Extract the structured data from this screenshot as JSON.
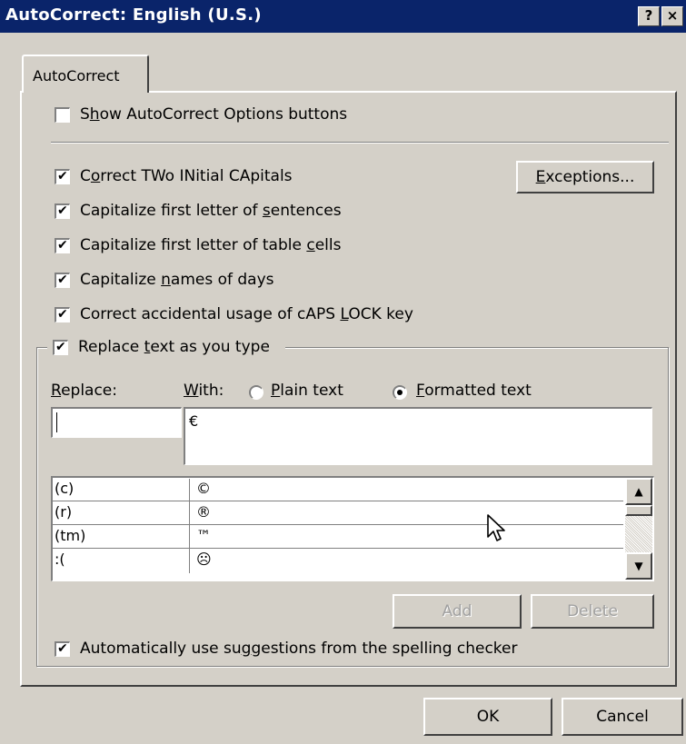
{
  "window": {
    "title": "AutoCorrect: English (U.S.)",
    "help_label": "?",
    "close_label": "×"
  },
  "tabs": [
    {
      "label": "AutoCorrect",
      "active": true
    }
  ],
  "options": {
    "show_buttons": {
      "label_pre": "S",
      "label_key": "h",
      "label_post": "ow AutoCorrect Options buttons",
      "checked": false
    },
    "correct_two_initial": {
      "label_pre": "C",
      "label_key": "o",
      "label_post": "rrect TWo INitial CApitals",
      "checked": true
    },
    "capitalize_sentences": {
      "label_pre": "Capitalize first letter of ",
      "label_key": "s",
      "label_post": "entences",
      "checked": true
    },
    "capitalize_table_cells": {
      "label_pre": "Capitalize first letter of table ",
      "label_key": "c",
      "label_post": "ells",
      "checked": true
    },
    "capitalize_days": {
      "label_pre": "Capitalize ",
      "label_key": "n",
      "label_post": "ames of days",
      "checked": true
    },
    "caps_lock": {
      "label_pre": "Correct accidental usage of cAPS ",
      "label_key": "L",
      "label_post": "OCK key",
      "checked": true
    },
    "replace_as_type": {
      "label_pre": "Replace ",
      "label_key": "t",
      "label_post": "ext as you type",
      "checked": true
    },
    "auto_suggestions": {
      "label_pre": "Automatically use su",
      "label_key": "g",
      "label_post": "gestions from the spelling checker",
      "checked": true
    }
  },
  "exceptions_button": {
    "label_key": "E",
    "label_post": "xceptions..."
  },
  "replace": {
    "replace_label_key": "R",
    "replace_label_post": "eplace:",
    "with_label_key": "W",
    "with_label_post": "ith:",
    "replace_value": "",
    "with_value": "€"
  },
  "format_options": {
    "plain": {
      "label_key": "P",
      "label_post": "lain text",
      "selected": false
    },
    "formatted": {
      "label_key": "F",
      "label_post": "ormatted text",
      "selected": true
    }
  },
  "entries": [
    {
      "replace": "(c)",
      "with": "©"
    },
    {
      "replace": "(r)",
      "with": "®"
    },
    {
      "replace": "(tm)",
      "with": "™"
    },
    {
      "replace": ":(",
      "with": "☹"
    }
  ],
  "scroll": {
    "up_icon": "▲",
    "down_icon": "▼"
  },
  "buttons": {
    "add": "Add",
    "delete": "Delete",
    "ok": "OK",
    "cancel": "Cancel"
  }
}
